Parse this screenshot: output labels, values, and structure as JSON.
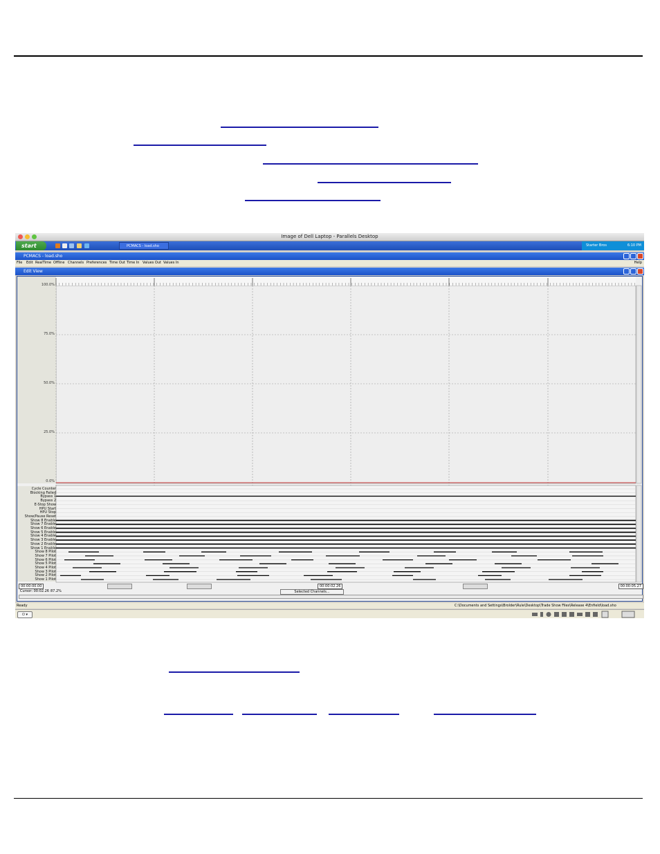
{
  "screenshot": {
    "mac_window_title": "Image of Dell Laptop - Parallels Desktop",
    "taskbar": {
      "start_label": "start",
      "task_button_label": "PCMACS - load.sho",
      "tray_text": "Starter Bros",
      "clock": "6:10 PM"
    },
    "app": {
      "title": "PCMACS - load.sho",
      "menu": [
        "File",
        "Edit",
        "RealTime",
        "Offline",
        "Channels",
        "Preferences",
        "Time Out",
        "Time In",
        "Values Out",
        "Values In"
      ],
      "help_label": "Help"
    },
    "edit_view": {
      "title": "Edit View",
      "y_axis_labels": [
        "100.0%",
        "75.0%",
        "50.0%",
        "25.0%",
        "0.0%"
      ],
      "channels": [
        "Cycle Counter",
        "Blocking Failed",
        "Bypass 1",
        "Bypass 2",
        "E-Stop Show",
        "HPU Start",
        "HPU Stop",
        "Show/Pause Reset",
        "Show 8 Enable",
        "Show 7 Enable",
        "Show 6 Enable",
        "Show 5 Enable",
        "Show 4 Enable",
        "Show 3 Enable",
        "Show 2 Enable",
        "Show 1 Enable",
        "Show 8 Pilot",
        "Show 7 Pilot",
        "Show 6 Pilot",
        "Show 5 Pilot",
        "Show 4 Pilot",
        "Show 3 Pilot",
        "Show 2 Pilot",
        "Show 1 Pilot"
      ],
      "time_start": "00:00:00.00",
      "time_mid": "00:00:02.26",
      "time_end": "00:00:05.27",
      "cursor_label": "Cursor: 00:02.26",
      "cursor_percent": "87.2%",
      "selected_channels_button": "Selected Channels..."
    },
    "status_bar": {
      "left": "Ready",
      "path": "C:\\Documents and Settings\\Brolder\\Rule\\Desktop\\Trade Show Files\\Release 4\\Enfield\\load.sho"
    }
  }
}
